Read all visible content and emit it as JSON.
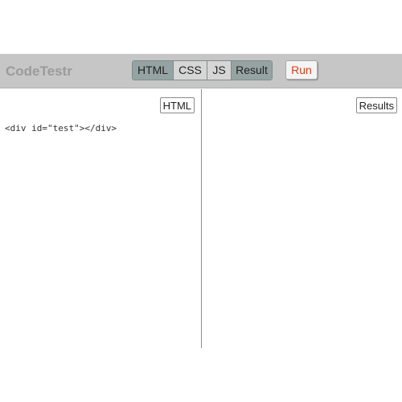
{
  "app": {
    "title": "CodeTestr"
  },
  "toolbar": {
    "tabs": [
      {
        "label": "HTML",
        "active": true
      },
      {
        "label": "CSS",
        "active": false
      },
      {
        "label": "JS",
        "active": false
      },
      {
        "label": "Result",
        "active": true
      }
    ],
    "run_label": "Run"
  },
  "panes": {
    "html": {
      "label": "HTML",
      "code": "<div id=\"test\"></div>"
    },
    "results": {
      "label": "Results"
    }
  },
  "colors": {
    "toolbar_bg": "#c6c6c6",
    "tab_active": "#95a4a2",
    "tab_inactive": "#d6d6d6",
    "run_text": "#d2411a",
    "title_text": "#9b9b9b"
  }
}
